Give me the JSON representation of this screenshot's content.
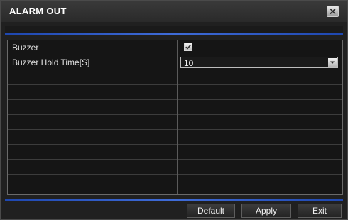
{
  "dialog": {
    "title": "ALARM OUT",
    "close_icon": "close-icon"
  },
  "settings": {
    "rows": [
      {
        "label": "Buzzer",
        "control": "checkbox",
        "checked": true
      },
      {
        "label": "Buzzer Hold Time[S]",
        "control": "select",
        "value": "10"
      }
    ],
    "empty_row_count": 8
  },
  "buttons": {
    "default_label": "Default",
    "apply_label": "Apply",
    "exit_label": "Exit"
  },
  "colors": {
    "background": "#202020",
    "accent": "#2f5ccc",
    "text": "#e0e0e0"
  }
}
